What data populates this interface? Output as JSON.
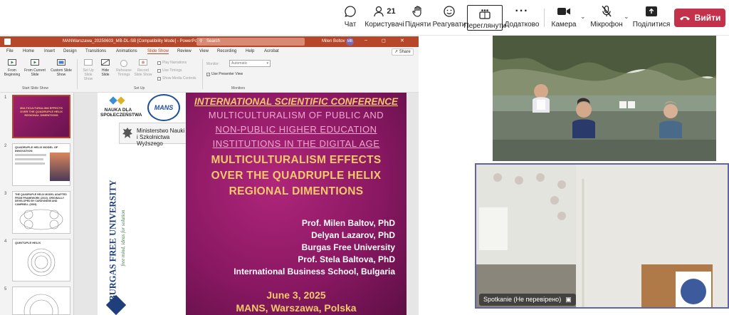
{
  "teams": {
    "toolbar": [
      {
        "id": "chat",
        "label": "Чат"
      },
      {
        "id": "people",
        "label": "Користувачі",
        "count": "21"
      },
      {
        "id": "raise",
        "label": "Підняти"
      },
      {
        "id": "react",
        "label": "Реагувати"
      },
      {
        "id": "view",
        "label": "Переглянути"
      },
      {
        "id": "more",
        "label": "Додатково"
      },
      {
        "id": "camera",
        "label": "Камера"
      },
      {
        "id": "mic",
        "label": "Мікрофон"
      },
      {
        "id": "share",
        "label": "Поділитися"
      }
    ],
    "leave_label": "Вийти",
    "colors": {
      "leave": "#c4314b",
      "accent": "#6264a7"
    }
  },
  "ppt": {
    "filename": "MANWarszawa_20250603_MB-DL-SB [Compatibility Mode] - PowerPoint",
    "search_placeholder": "Search",
    "user": "Milen Boltov",
    "user_initials": "MB",
    "menu": [
      "File",
      "Home",
      "Insert",
      "Design",
      "Transitions",
      "Animations",
      "Slide Show",
      "Review",
      "View",
      "Recording",
      "Help",
      "Acrobat"
    ],
    "active_menu": "Slide Show",
    "share_label": "Share",
    "ribbon": {
      "from_beginning": "From Beginning",
      "from_current": "From Current Slide",
      "custom_show": "Custom Slide Show",
      "group_start": "Start Slide Show",
      "set_up": "Set Up Slide Show",
      "hide_slide": "Hide Slide",
      "rehearse": "Rehearse Timings",
      "record": "Record Slide Show",
      "play_narrations": "Play Narrations",
      "use_timings": "Use Timings",
      "show_media": "Show Media Controls",
      "group_setup": "Set Up",
      "monitor_label": "Monitor:",
      "monitor_value": "Automatic",
      "presenter_view": "Use Presenter View",
      "group_monitors": "Monitors"
    },
    "thumbnails": [
      {
        "num": "1",
        "title": "MULTICULTURALISM EFFECTS OVER THE QUADRUPLE HELIX REGIONAL DIMENTIONS"
      },
      {
        "num": "2",
        "title": "QUADRUPLE HELIX MODEL OF INNOVATION"
      },
      {
        "num": "3",
        "title": "THE QUADRUPLE HELIX MODEL ADAPTED FROM FRAMEWORK (2010), ORIGINALLY DEVELOPED BY CARAYANNIS AND CAMPBELL (2009)"
      },
      {
        "num": "4",
        "title": "QUINTUPLE HELIX"
      },
      {
        "num": "5",
        "title": ""
      }
    ]
  },
  "slide": {
    "logo_nauka_1": "NAUKA DLA",
    "logo_nauka_2": "SPOŁECZEŃSTWA",
    "logo_mans": "MANS",
    "ministry_1": "Ministerstwo Nauki",
    "ministry_2": "i Szkolnictwa Wyższego",
    "university": "BURGAS FREE UNIVERSITY",
    "university_motto": "free mind, ideas for solution",
    "conf_title": "INTERNATIONAL SCIENTIFIC CONFERENCE",
    "subtitle_lines": [
      "MULTICULTURALISM OF PUBLIC AND",
      "NON-PUBLIC HIGHER EDUCATION",
      "INSTITUTIONS IN THE DIGITAL AGE"
    ],
    "main_lines": [
      "MULTICULTURALISM EFFECTS",
      "OVER THE QUADRUPLE HELIX",
      "REGIONAL DIMENTIONS"
    ],
    "authors": [
      "Prof. Milen Baltov, PhD",
      "Delyan Lazarov, PhD",
      "Burgas Free University",
      "Prof. Stela Baltova, PhD",
      "International Business School, Bulgaria"
    ],
    "date": "June 3, 2025",
    "place": "MANS, Warszawa, Polska"
  },
  "video": {
    "bottom_name": "Spotkanie (Не перевірено)"
  }
}
